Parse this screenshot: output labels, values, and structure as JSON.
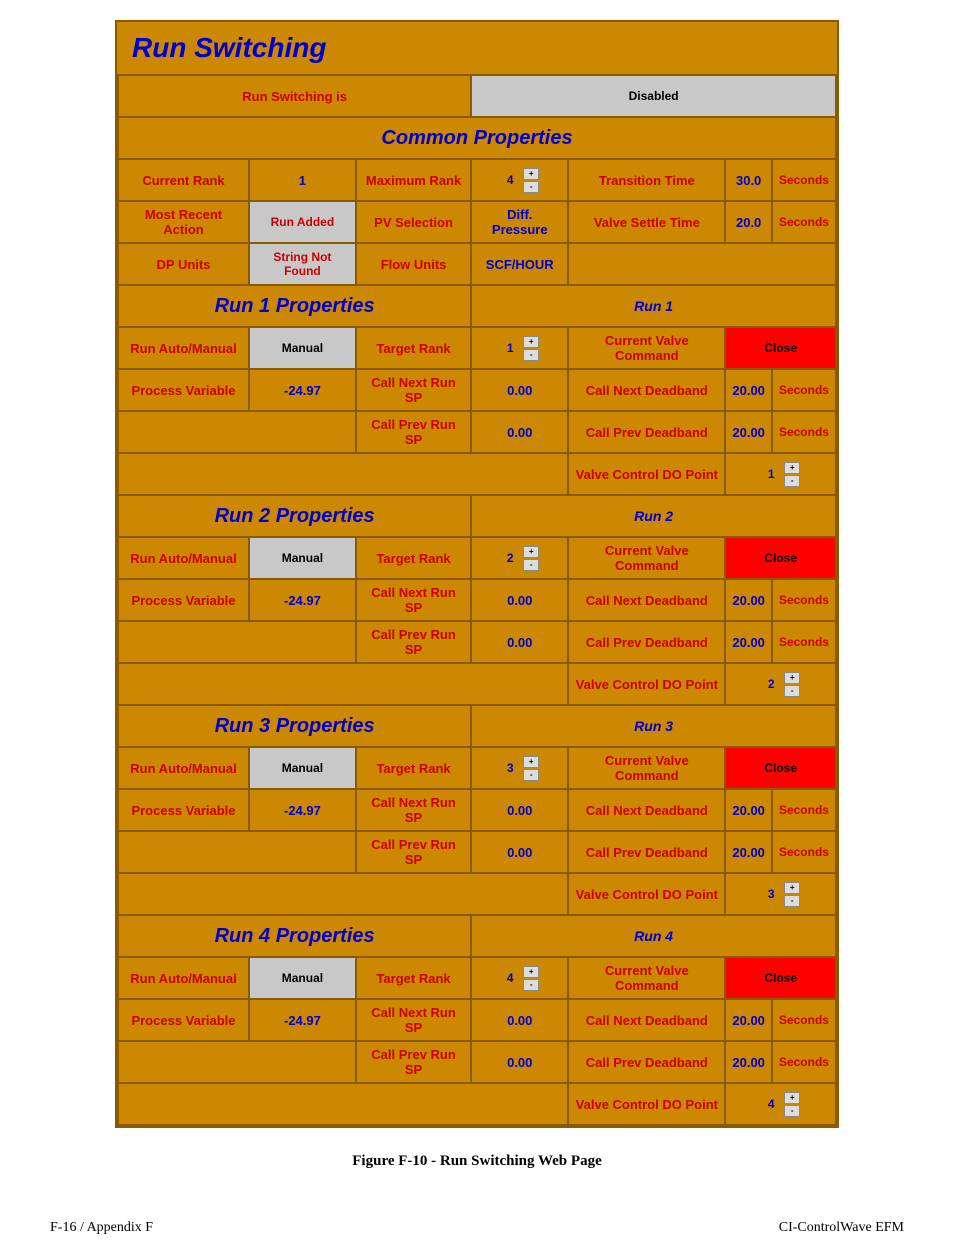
{
  "title": "Run Switching",
  "status": {
    "label": "Run Switching is",
    "value": "Disabled"
  },
  "common": {
    "header": "Common Properties",
    "currentRank": {
      "l": "Current Rank",
      "v": "1"
    },
    "maxRank": {
      "l": "Maximum Rank",
      "v": "4"
    },
    "transTime": {
      "l": "Transition Time",
      "v": "30.0",
      "u": "Seconds"
    },
    "mra": {
      "l": "Most Recent Action",
      "v": "Run Added"
    },
    "pvsel": {
      "l": "PV Selection",
      "v": "Diff. Pressure"
    },
    "valveSettle": {
      "l": "Valve Settle Time",
      "v": "20.0",
      "u": "Seconds"
    },
    "dpUnits": {
      "l": "DP Units",
      "v": "String Not Found"
    },
    "flowUnits": {
      "l": "Flow Units",
      "v": "SCF/HOUR"
    }
  },
  "labels": {
    "ram": "Run Auto/Manual",
    "tr": "Target Rank",
    "cvc": "Current Valve Command",
    "pv": "Process Variable",
    "cnsp": "Call Next Run SP",
    "cnd": "Call Next Deadband",
    "cpsp": "Call Prev Run SP",
    "cpd": "Call Prev Deadband",
    "vcdo": "Valve Control DO Point",
    "sec": "Seconds"
  },
  "runs": [
    {
      "hdr": "Run 1 Properties",
      "name": "Run 1",
      "mode": "Manual",
      "rank": "1",
      "cmd": "Close",
      "pv": "-24.97",
      "cnsp": "0.00",
      "cnd": "20.00",
      "cpsp": "0.00",
      "cpd": "20.00",
      "vcdo": "1"
    },
    {
      "hdr": "Run 2 Properties",
      "name": "Run 2",
      "mode": "Manual",
      "rank": "2",
      "cmd": "Close",
      "pv": "-24.97",
      "cnsp": "0.00",
      "cnd": "20.00",
      "cpsp": "0.00",
      "cpd": "20.00",
      "vcdo": "2"
    },
    {
      "hdr": "Run 3 Properties",
      "name": "Run 3",
      "mode": "Manual",
      "rank": "3",
      "cmd": "Close",
      "pv": "-24.97",
      "cnsp": "0.00",
      "cnd": "20.00",
      "cpsp": "0.00",
      "cpd": "20.00",
      "vcdo": "3"
    },
    {
      "hdr": "Run 4 Properties",
      "name": "Run 4",
      "mode": "Manual",
      "rank": "4",
      "cmd": "Close",
      "pv": "-24.97",
      "cnsp": "0.00",
      "cnd": "20.00",
      "cpsp": "0.00",
      "cpd": "20.00",
      "vcdo": "4"
    }
  ],
  "caption": "Figure F-10 - Run Switching Web Page",
  "footer": {
    "left": "F-16 / Appendix F",
    "right": "CI-ControlWave EFM"
  }
}
